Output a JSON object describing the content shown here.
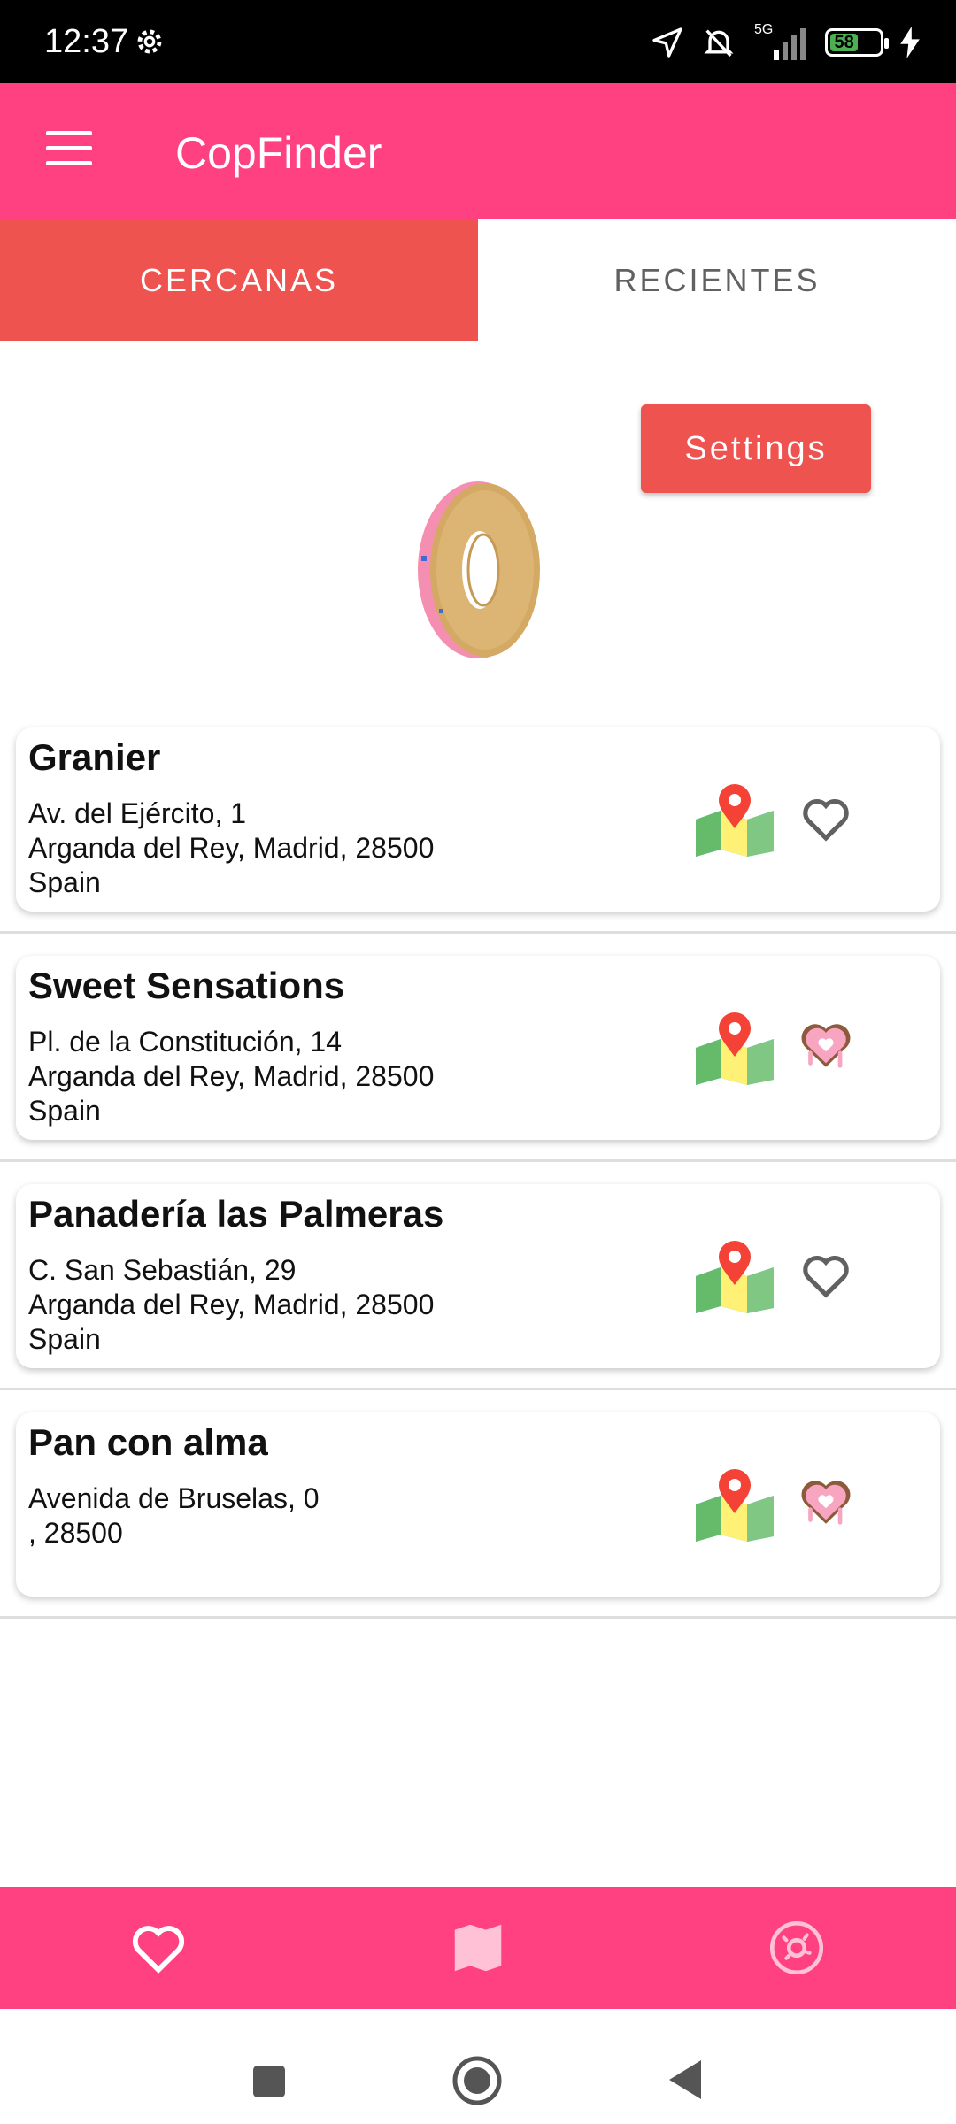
{
  "status_bar": {
    "time": "12:37",
    "network": "5G",
    "battery": "58"
  },
  "app_bar": {
    "title": "CopFinder"
  },
  "tabs": [
    {
      "label": "CERCANAS",
      "active": true
    },
    {
      "label": "RECIENTES",
      "active": false
    }
  ],
  "settings_button": {
    "label": "Settings"
  },
  "places": [
    {
      "name": "Granier",
      "address_lines": [
        "Av. del Ejército, 1",
        "Arganda del Rey, Madrid, 28500",
        "Spain"
      ],
      "favorite": false
    },
    {
      "name": "Sweet Sensations",
      "address_lines": [
        "Pl. de la Constitución, 14",
        "Arganda del Rey, Madrid, 28500",
        "Spain"
      ],
      "favorite": true
    },
    {
      "name": "Panadería las Palmeras",
      "address_lines": [
        "C. San Sebastián, 29",
        "Arganda del Rey, Madrid, 28500",
        "Spain"
      ],
      "favorite": false
    },
    {
      "name": "Pan con alma",
      "address_lines": [
        "Avenida de Bruselas, 0",
        ", 28500",
        ""
      ],
      "favorite": true
    }
  ],
  "bottom_nav": {
    "items": [
      "heart-icon",
      "map-icon",
      "donut-icon"
    ]
  },
  "colors": {
    "primary": "#ff4081",
    "accent": "#ef5350"
  }
}
